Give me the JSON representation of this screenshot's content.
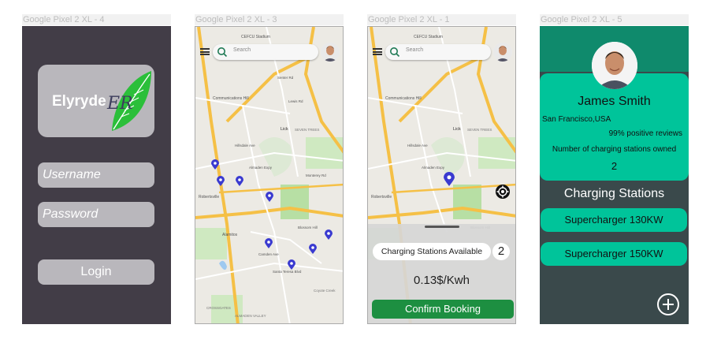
{
  "frames": {
    "login": "Google Pixel 2 XL - 4",
    "map": "Google Pixel 2 XL - 3",
    "booking": "Google Pixel 2 XL - 1",
    "profile": "Google Pixel 2 XL - 5"
  },
  "login": {
    "app_name": "Elyryde",
    "logo_initials": "ER",
    "username_placeholder": "Username",
    "password_placeholder": "Password",
    "login_label": "Login"
  },
  "map": {
    "search_placeholder": "Search",
    "stadium": "CEFCU Stadium",
    "labels": [
      "Communications Hill",
      "Hillsdale Ave",
      "Lick",
      "SEVEN TREES",
      "Robertsville",
      "Almaden Expy",
      "Alamitos",
      "Camden Ave",
      "Santa Teresa Blvd",
      "Blossom Hill",
      "Senter Rd",
      "Lewis Rd",
      "Monterey Rd",
      "CROSSGATES",
      "ALMADEN VALLEY",
      "Coyote Creek"
    ]
  },
  "booking": {
    "available_label": "Charging Stations Available",
    "available_count": "2",
    "price": "0.13$/Kwh",
    "confirm_label": "Confirm Booking"
  },
  "profile": {
    "name": "James Smith",
    "location": "San Francisco,USA",
    "reviews": "99% positive reviews",
    "owned_label": "Number of charging stations owned",
    "owned_count": "2",
    "stations_title": "Charging Stations",
    "stations": [
      "Supercharger 130KW",
      "Supercharger 150KW"
    ]
  },
  "colors": {
    "login_bg": "#423d47",
    "login_card": "#b9b7bc",
    "profile_accent": "#00c49a",
    "profile_bg": "#3a494b",
    "confirm_green": "#1d8f41",
    "pin_blue": "#3a3ad0"
  }
}
